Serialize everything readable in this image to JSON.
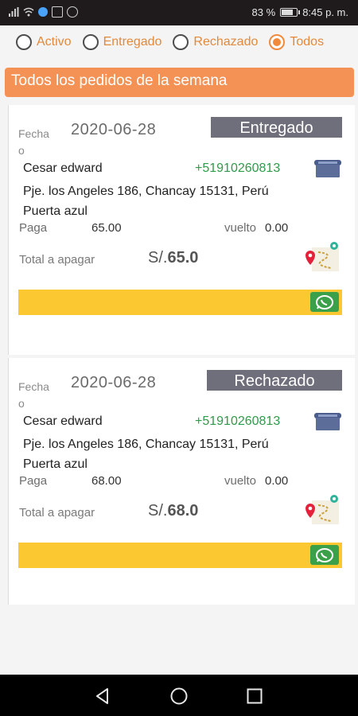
{
  "status_bar": {
    "battery_text": "83 %",
    "battery_level": 0.83,
    "time": "8:45 p. m.",
    "icons": [
      "signal-icon",
      "wifi-icon",
      "notification-dot-icon",
      "image-icon",
      "target-icon"
    ]
  },
  "filters": {
    "options": [
      "Activo",
      "Entregado",
      "Rechazado",
      "Todos"
    ],
    "selected": "Todos"
  },
  "banner": {
    "title": "Todos los pedidos de la semana"
  },
  "colors": {
    "accent": "#f28a3c",
    "banner": "#f49256",
    "badge": "#6f6f7b",
    "phone": "#2f9a4a",
    "bar": "#fcc831",
    "whatsapp": "#3aa04a"
  },
  "orders": [
    {
      "fecha_label": "Fecha o",
      "date": "2020-06-28",
      "status": "Entregado",
      "customer": "Cesar edward",
      "phone": "+51910260813",
      "address": "Pje. los Angeles 186, Chancay 15131, Perú",
      "reference": "Puerta azul",
      "paga_label": "Paga",
      "paga": "65.00",
      "vuelto_label": "vuelto",
      "vuelto": "0.00",
      "total_label": "Total a apagar",
      "currency": "S/.",
      "total": "65.0"
    },
    {
      "fecha_label": "Fecha o",
      "date": "2020-06-28",
      "status": "Rechazado",
      "customer": "Cesar edward",
      "phone": "+51910260813",
      "address": "Pje. los Angeles 186, Chancay 15131, Perú",
      "reference": "Puerta azul",
      "paga_label": "Paga",
      "paga": "68.00",
      "vuelto_label": "vuelto",
      "vuelto": "0.00",
      "total_label": "Total a apagar",
      "currency": "S/.",
      "total": "68.0"
    }
  ],
  "nav": {
    "icons": [
      "back-icon",
      "home-icon",
      "recents-icon"
    ]
  }
}
